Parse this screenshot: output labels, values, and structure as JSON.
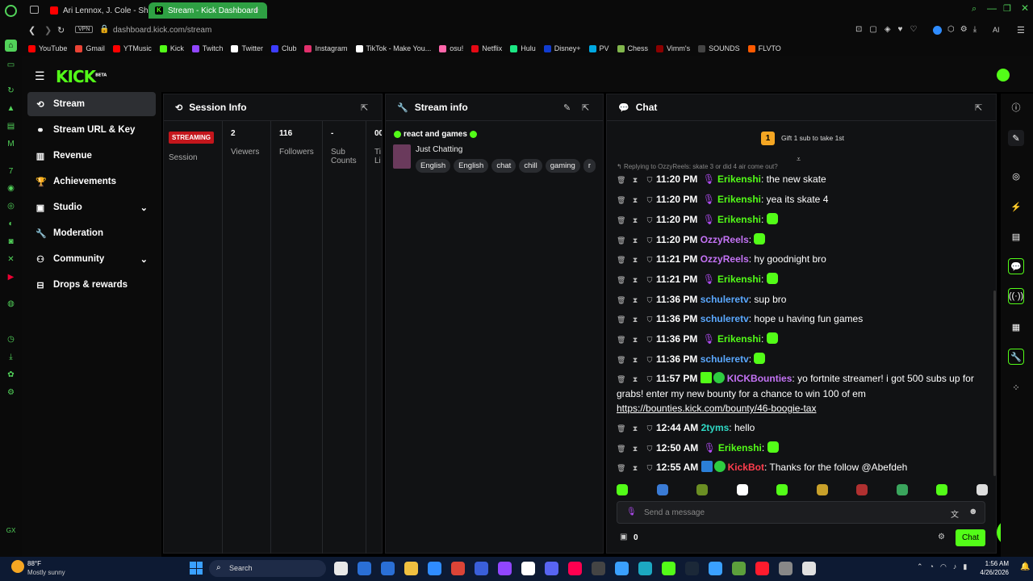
{
  "browser": {
    "tabs": [
      {
        "label": "Ari Lennox, J. Cole - Shea"
      },
      {
        "label": "Stream - Kick Dashboard"
      }
    ],
    "new_tab": "+",
    "vpn": "VPN",
    "url_host": "dashboard.kick.com",
    "url_path": "/stream",
    "ai": "AI",
    "bookmarks": [
      {
        "label": "YouTube",
        "color": "#ff0000"
      },
      {
        "label": "Gmail",
        "color": "#ea4335"
      },
      {
        "label": "YTMusic",
        "color": "#ff0000"
      },
      {
        "label": "Kick",
        "color": "#53fc18"
      },
      {
        "label": "Twitch",
        "color": "#9146ff"
      },
      {
        "label": "Twitter",
        "color": "#ffffff"
      },
      {
        "label": "Club",
        "color": "#3d3dff"
      },
      {
        "label": "Instagram",
        "color": "#e1306c"
      },
      {
        "label": "TikTok - Make You...",
        "color": "#ffffff"
      },
      {
        "label": "osu!",
        "color": "#ff66aa"
      },
      {
        "label": "Netflix",
        "color": "#e50914"
      },
      {
        "label": "Hulu",
        "color": "#1ce783"
      },
      {
        "label": "Disney+",
        "color": "#113ccf"
      },
      {
        "label": "PV",
        "color": "#00a8e1"
      },
      {
        "label": "Chess",
        "color": "#81b64c"
      },
      {
        "label": "Vimm's",
        "color": "#8b0000"
      },
      {
        "label": "SOUNDS",
        "color": "#444444"
      },
      {
        "label": "FLVTO",
        "color": "#ff5a00"
      }
    ]
  },
  "kick": {
    "logo": "KICK",
    "beta": "BETA"
  },
  "sidebar": {
    "items": [
      {
        "label": "Stream",
        "icon": "stream-icon",
        "glyph": "⟲"
      },
      {
        "label": "Stream URL & Key",
        "icon": "link-icon",
        "glyph": "⚭"
      },
      {
        "label": "Revenue",
        "icon": "chart-icon",
        "glyph": "▥"
      },
      {
        "label": "Achievements",
        "icon": "trophy-icon",
        "glyph": "🏆"
      },
      {
        "label": "Studio",
        "icon": "studio-icon",
        "glyph": "▣"
      },
      {
        "label": "Moderation",
        "icon": "wrench-icon",
        "glyph": "🔧"
      },
      {
        "label": "Community",
        "icon": "community-icon",
        "glyph": "⚇"
      },
      {
        "label": "Drops & rewards",
        "icon": "gift-icon",
        "glyph": "⊟"
      }
    ]
  },
  "session": {
    "title": "Session Info",
    "status": "STREAMING",
    "session_label": "Session",
    "stats": [
      {
        "value": "2",
        "label": "Viewers"
      },
      {
        "value": "116",
        "label": "Followers"
      },
      {
        "value": "-",
        "label": "Sub Counts"
      },
      {
        "value": "00",
        "label": "Ti Li"
      }
    ]
  },
  "stream_info": {
    "title": "Stream info",
    "stream_title": "react and games",
    "category": "Just Chatting",
    "tags": [
      "English",
      "English",
      "chat",
      "chill",
      "gaming",
      "r"
    ]
  },
  "chat": {
    "title": "Chat",
    "gift_rank": "1",
    "gift_text": "Gift 1 sub to take 1st",
    "reply_preview": "Replying to OzzyReels: skate 3 or did 4 air come out?",
    "messages": [
      {
        "time": "11:20 PM",
        "user": "Erikenshi",
        "color": "green",
        "mic": true,
        "text": "the new skate"
      },
      {
        "time": "11:20 PM",
        "user": "Erikenshi",
        "color": "green",
        "mic": true,
        "text": "yea its skate 4"
      },
      {
        "time": "11:20 PM",
        "user": "Erikenshi",
        "color": "green",
        "mic": true,
        "text": "",
        "emote": true
      },
      {
        "time": "11:20 PM",
        "user": "OzzyReels",
        "color": "purple",
        "mic": false,
        "text": "",
        "emote": true
      },
      {
        "time": "11:21 PM",
        "user": "OzzyReels",
        "color": "purple",
        "mic": false,
        "text": "hy goodnight bro"
      },
      {
        "time": "11:21 PM",
        "user": "Erikenshi",
        "color": "green",
        "mic": true,
        "text": "",
        "emote": true
      },
      {
        "time": "11:36 PM",
        "user": "schuleretv",
        "color": "blue",
        "mic": false,
        "text": "sup bro"
      },
      {
        "time": "11:36 PM",
        "user": "schuleretv",
        "color": "blue",
        "mic": false,
        "text": "hope u having fun games"
      },
      {
        "time": "11:36 PM",
        "user": "Erikenshi",
        "color": "green",
        "mic": true,
        "text": "",
        "emote": true
      },
      {
        "time": "11:36 PM",
        "user": "schuleretv",
        "color": "blue",
        "mic": false,
        "text": "",
        "emote": true
      }
    ],
    "bounty": {
      "time": "11:57 PM",
      "user": "KICKBounties",
      "text": "yo fortnite streamer! i got 500 subs up for grabs! enter my new bounty for a chance to win 100 of em",
      "link": "https://bounties.kick.com/bounty/46-boogie-tax"
    },
    "after": [
      {
        "time": "12:44 AM",
        "user": "2tyms",
        "color": "teal",
        "mic": false,
        "text": "hello"
      },
      {
        "time": "12:50 AM",
        "user": "Erikenshi",
        "color": "green",
        "mic": true,
        "text": "",
        "emote": true
      },
      {
        "time": "12:55 AM",
        "user": "KickBot",
        "color": "red",
        "mic": false,
        "text": "Thanks for the follow @Abefdeh"
      }
    ],
    "input_placeholder": "Send a message",
    "points": "0",
    "send_label": "Chat"
  },
  "taskbar": {
    "weather_temp": "88°F",
    "weather_desc": "Mostly sunny",
    "search": "Search",
    "time": "1:56 AM",
    "date": "4/26/2026"
  }
}
